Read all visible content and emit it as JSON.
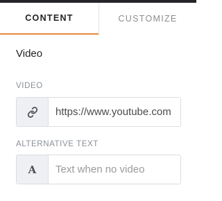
{
  "tabs": [
    {
      "label": "CONTENT",
      "active": true
    },
    {
      "label": "CUSTOMIZE",
      "active": false
    }
  ],
  "panel": {
    "title": "Video"
  },
  "fields": {
    "video": {
      "label": "VIDEO",
      "icon": "link-icon",
      "value": "https://www.youtube.com"
    },
    "alt_text": {
      "label": "ALTERNATIVE TEXT",
      "icon": "text-letter-a-icon",
      "icon_glyph": "A",
      "placeholder": "Text when no video",
      "value": ""
    }
  },
  "colors": {
    "accent": "#e8893a",
    "topbar": "#23252a",
    "addon_bg": "#eef0f3",
    "border": "#dcdde0"
  }
}
